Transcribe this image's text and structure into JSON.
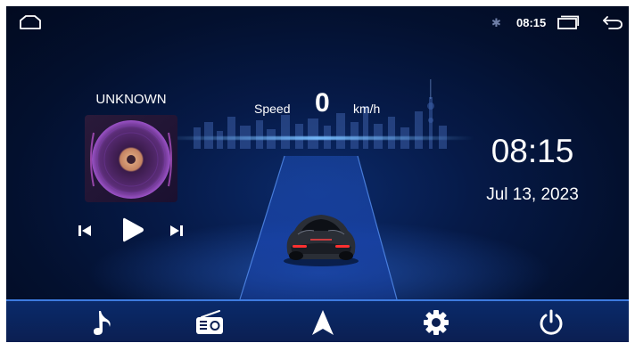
{
  "status_bar": {
    "time": "08:15",
    "icons": [
      "home-icon",
      "bluetooth-icon",
      "recent-apps-icon",
      "back-icon"
    ]
  },
  "speed": {
    "label": "Speed",
    "value": "0",
    "unit": "km/h"
  },
  "music": {
    "title": "UNKNOWN",
    "controls": [
      "previous-icon",
      "play-icon",
      "next-icon"
    ]
  },
  "clock": {
    "time": "08:15",
    "date": "Jul 13, 2023"
  },
  "dock": {
    "items": [
      "music-icon",
      "radio-icon",
      "navigation-icon",
      "settings-icon",
      "power-icon"
    ]
  },
  "colors": {
    "accent": "#3d7be0",
    "background": "#03102e",
    "text": "#ffffff"
  }
}
